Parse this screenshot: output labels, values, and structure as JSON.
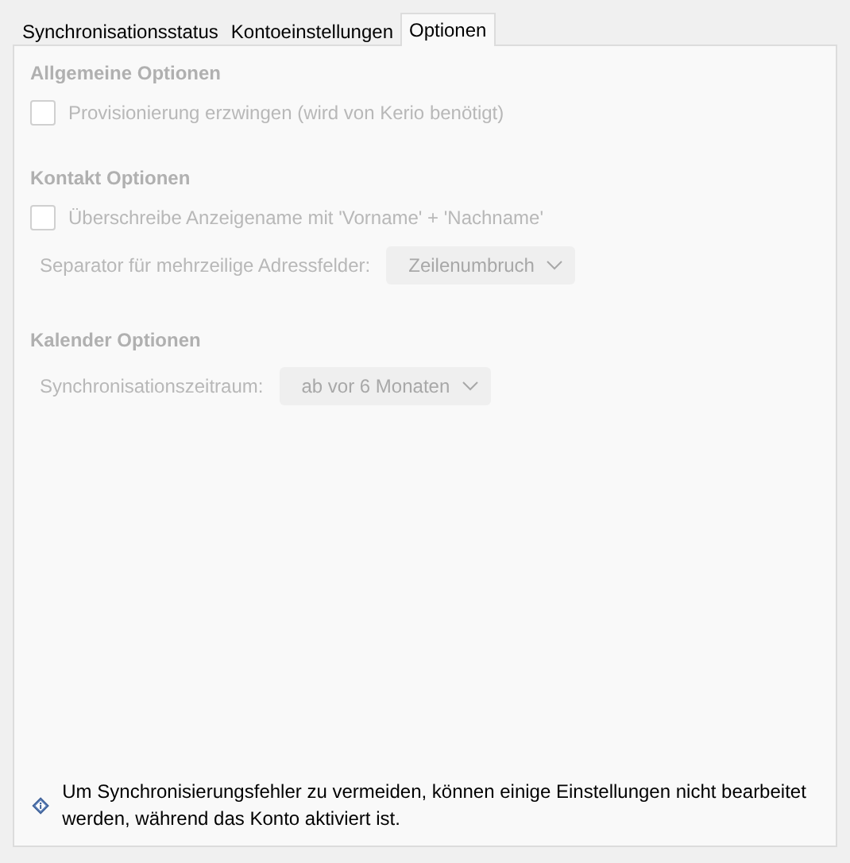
{
  "tabs": [
    {
      "label": "Synchronisationsstatus",
      "selected": false
    },
    {
      "label": "Kontoeinstellungen",
      "selected": false
    },
    {
      "label": "Optionen",
      "selected": true
    }
  ],
  "sections": [
    {
      "title": "Allgemeine Optionen",
      "disabled": true,
      "items": [
        {
          "kind": "checkbox",
          "label": "Provisionierung erzwingen (wird von Kerio benötigt)",
          "checked": false
        }
      ]
    },
    {
      "title": "Kontakt Optionen",
      "disabled": true,
      "items": [
        {
          "kind": "checkbox",
          "label": "Überschreibe Anzeigename mit 'Vorname' + 'Nachname'",
          "checked": false
        },
        {
          "kind": "dropdown",
          "label": "Separator für mehrzeilige Adressfelder:",
          "value": "Zeilenumbruch"
        }
      ]
    },
    {
      "title": "Kalender Optionen",
      "disabled": true,
      "items": [
        {
          "kind": "dropdown",
          "label": "Synchronisationszeitraum:",
          "value": "ab vor 6 Monaten"
        }
      ]
    }
  ],
  "notice": "Um Synchronisierungsfehler zu vermeiden, können einige Einstellungen nicht bearbeitet werden, während das Konto aktiviert ist."
}
